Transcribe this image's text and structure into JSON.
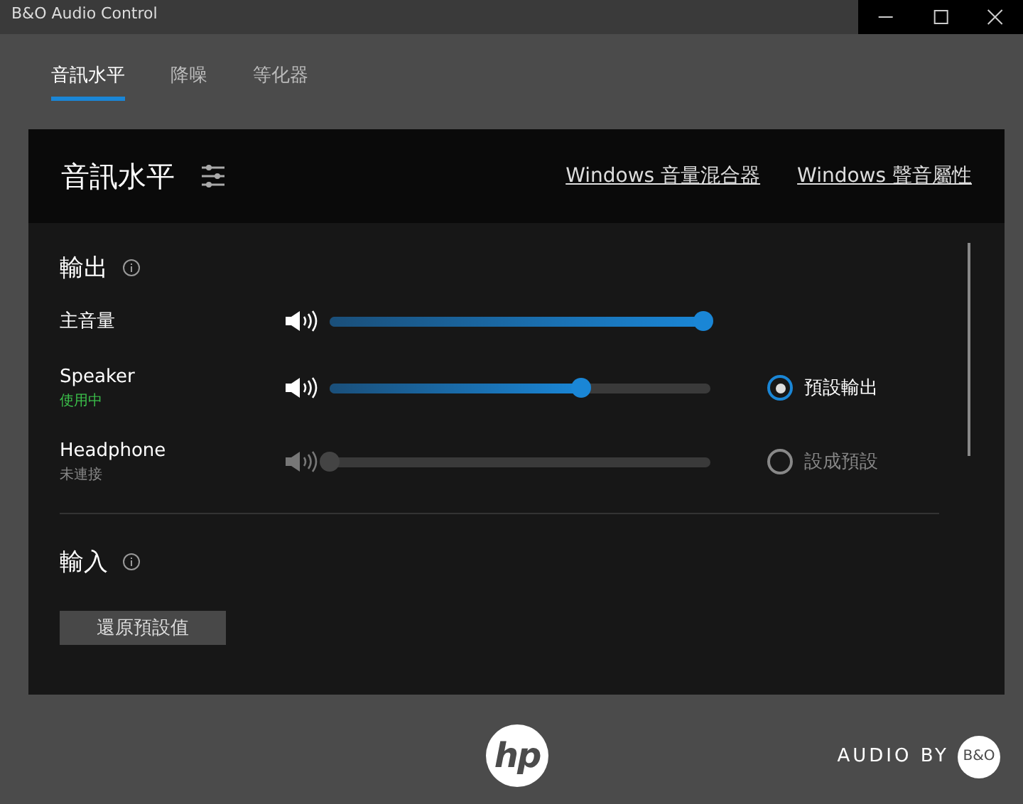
{
  "window": {
    "title": "B&O Audio Control"
  },
  "tabs": [
    {
      "label": "音訊水平",
      "selected": true
    },
    {
      "label": "降噪",
      "selected": false
    },
    {
      "label": "等化器",
      "selected": false
    }
  ],
  "panel": {
    "title": "音訊水平",
    "links": [
      "Windows 音量混合器",
      "Windows 聲音屬性"
    ]
  },
  "output": {
    "title": "輸出",
    "master": {
      "label": "主音量",
      "level": 0.98
    },
    "devices": [
      {
        "name": "Speaker",
        "status": "使用中",
        "connected": true,
        "level": 0.66,
        "option": "預設輸出",
        "selected": true
      },
      {
        "name": "Headphone",
        "status": "未連接",
        "connected": false,
        "level": 0,
        "option": "設成預設",
        "selected": false
      }
    ]
  },
  "input": {
    "title": "輸入"
  },
  "reset_button": "還原預設值",
  "footer": {
    "logo": "hp",
    "brand_text": "AUDIO BY",
    "brand_logo": "B&O"
  }
}
